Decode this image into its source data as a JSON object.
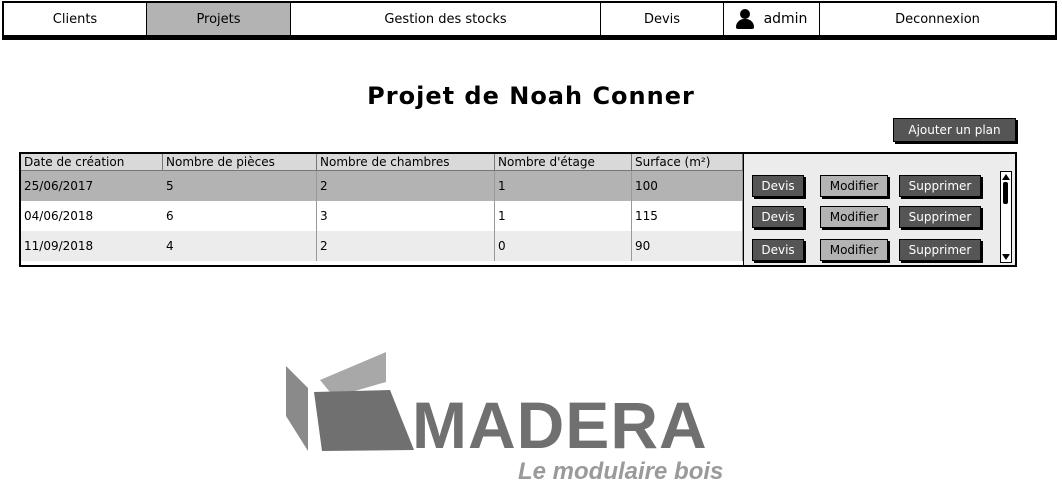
{
  "nav": {
    "items": [
      {
        "label": "Clients"
      },
      {
        "label": "Projets"
      },
      {
        "label": "Gestion des stocks"
      },
      {
        "label": "Devis"
      },
      {
        "label": "admin",
        "icon": "user-icon"
      },
      {
        "label": "Deconnexion"
      }
    ],
    "active": "Projets"
  },
  "page": {
    "title": "Projet de Noah Conner",
    "add_plan_label": "Ajouter un plan"
  },
  "table": {
    "columns": [
      "Date de création",
      "Nombre de pièces",
      "Nombre de chambres",
      "Nombre d'étage",
      "Surface (m²)"
    ],
    "rows": [
      {
        "date": "25/06/2017",
        "pieces": "5",
        "chambres": "2",
        "etages": "1",
        "surface": "100"
      },
      {
        "date": "04/06/2018",
        "pieces": "6",
        "chambres": "3",
        "etages": "1",
        "surface": "115"
      },
      {
        "date": "11/09/2018",
        "pieces": "4",
        "chambres": "2",
        "etages": "0",
        "surface": "90"
      }
    ],
    "actions": {
      "devis": "Devis",
      "modifier": "Modifier",
      "supprimer": "Supprimer"
    }
  },
  "logo": {
    "name": "MADERA",
    "tagline": "Le modulaire bois"
  },
  "colors": {
    "active_tab": "#b3b3b3",
    "dark_button": "#555555",
    "logo_gray": "#707070"
  }
}
